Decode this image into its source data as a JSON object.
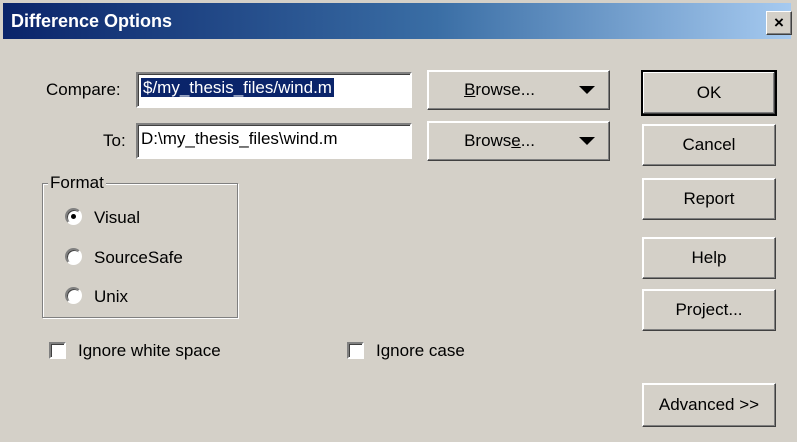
{
  "window": {
    "title": "Difference Options",
    "close_label": "×"
  },
  "compare": {
    "label": "Compare:",
    "value": "$/my_thesis_files/wind.m",
    "browse_pre": "B",
    "browse_rest": "rowse...",
    "browse_icon": "dropdown-arrow"
  },
  "to": {
    "label": "To:",
    "value": "D:\\my_thesis_files\\wind.m",
    "browse_pre": "Brows",
    "browse_ul": "e",
    "browse_rest": "..."
  },
  "format": {
    "title": "Format",
    "options": [
      {
        "label": "Visual",
        "selected": true
      },
      {
        "label": "SourceSafe",
        "selected": false
      },
      {
        "label": "Unix",
        "selected": false
      }
    ]
  },
  "options": {
    "ignore_white_space": {
      "label": "Ignore white space",
      "checked": false
    },
    "ignore_case": {
      "label": "Ignore case",
      "checked": false
    }
  },
  "buttons": {
    "ok": "OK",
    "cancel": "Cancel",
    "report": "Report",
    "help": "Help",
    "project": "Project...",
    "advanced": "Advanced >>"
  }
}
